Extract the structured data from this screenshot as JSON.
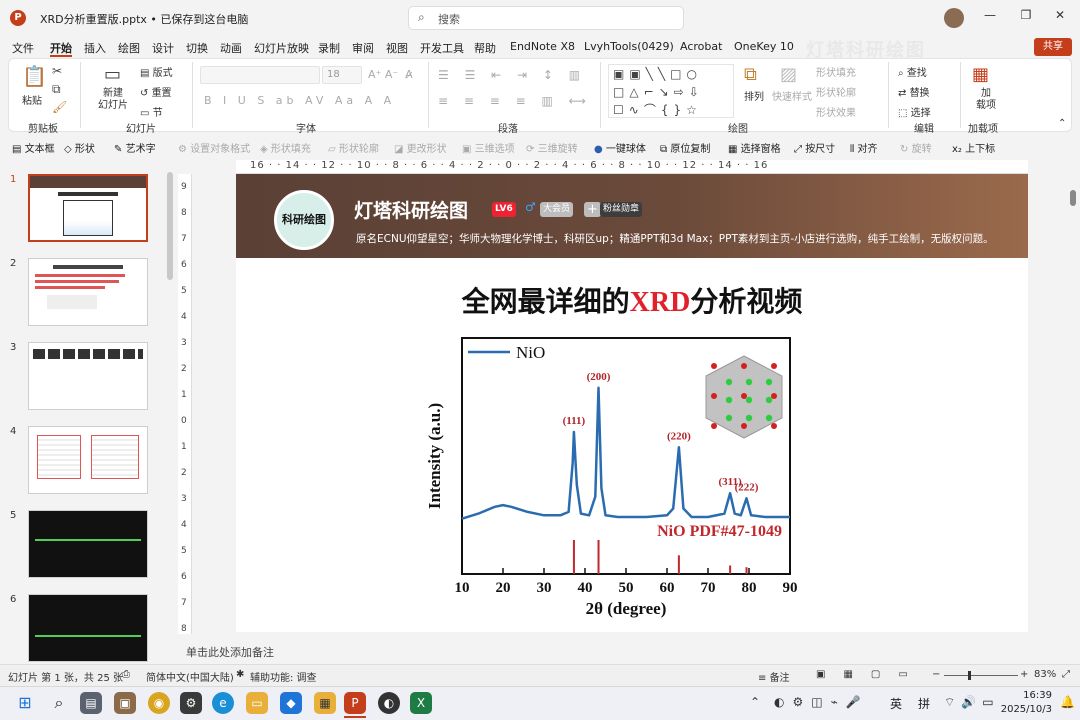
{
  "titlebar": {
    "file_title": "XRD分析重置版.pptx • 已保存到这台电脑",
    "search_placeholder": "搜索",
    "minimize": "—",
    "restore": "❐",
    "close": "✕",
    "logo_letter": "P"
  },
  "menu": [
    "文件",
    "开始",
    "插入",
    "绘图",
    "设计",
    "切换",
    "动画",
    "幻灯片放映",
    "录制",
    "审阅",
    "视图",
    "开发工具",
    "帮助",
    "EndNote X8",
    "LvyhTools(0429)",
    "Acrobat",
    "OneKey 10"
  ],
  "watermark": "灯塔科研绘图",
  "share_label": "共享",
  "ribbon": {
    "groups": [
      "剪贴板",
      "幻灯片",
      "字体",
      "段落",
      "绘图",
      "编辑",
      "加载项"
    ],
    "paste": "粘贴",
    "new_slide": "新建\n幻灯片",
    "layout": "版式",
    "reset": "重置",
    "section": "节",
    "font_size": "18",
    "arrange": "排列",
    "quick_styles": "快速样式",
    "shape_fill": "形状填充",
    "shape_outline": "形状轮廓",
    "shape_effects": "形状效果",
    "find": "查找",
    "replace": "替换",
    "select": "选择",
    "addins": "加\n载项"
  },
  "toolbar2": [
    {
      "label": "文本框",
      "icon": "textbox-icon",
      "enabled": true
    },
    {
      "label": "形状",
      "icon": "shapes-icon",
      "enabled": true
    },
    {
      "label": "艺术字",
      "icon": "wordart-icon",
      "enabled": true
    },
    {
      "label": "设置对象格式",
      "icon": "format-icon",
      "enabled": false
    },
    {
      "label": "形状填充",
      "icon": "fill-icon",
      "enabled": false
    },
    {
      "label": "形状轮廓",
      "icon": "outline-icon",
      "enabled": false
    },
    {
      "label": "更改形状",
      "icon": "change-shape-icon",
      "enabled": false
    },
    {
      "label": "三维选项",
      "icon": "3d-icon",
      "enabled": false
    },
    {
      "label": "三维旋转",
      "icon": "3d-rotate-icon",
      "enabled": false
    },
    {
      "label": "一键球体",
      "icon": "sphere-icon",
      "enabled": true
    },
    {
      "label": "原位复制",
      "icon": "copy-icon",
      "enabled": true
    },
    {
      "label": "选择窗格",
      "icon": "pane-icon",
      "enabled": true
    },
    {
      "label": "按尺寸",
      "icon": "size-icon",
      "enabled": true
    },
    {
      "label": "对齐",
      "icon": "align-icon",
      "enabled": true
    },
    {
      "label": "旋转",
      "icon": "rotate-icon",
      "enabled": false
    },
    {
      "label": "上下标",
      "icon": "subscript-icon",
      "enabled": true
    }
  ],
  "slides": [
    {
      "num": "1",
      "selected": true
    },
    {
      "num": "2",
      "selected": false
    },
    {
      "num": "3",
      "selected": false
    },
    {
      "num": "4",
      "selected": false
    },
    {
      "num": "5",
      "selected": false
    },
    {
      "num": "6",
      "selected": false
    }
  ],
  "ruler_top": "16 · · 14 · · 12 · · 10 · · 8 · · 6 · · 4 · · 2 · · 0 · · 2 · · 4 · · 6 · · 8 · · 10 · · 12 · · 14 · · 16",
  "ruler_left": "9 8 7 6 5 4 3 2 1 0 1 2 3 4 5 6 7 8",
  "slide": {
    "banner": {
      "name": "灯塔科研绘图",
      "logo_text": "科研绘图",
      "level": "LV6",
      "vip": "大会员",
      "medal": "粉丝勋章",
      "desc": "原名ECNU仰望星空；华师大物理化学博士，科研区up；精通PPT和3d Max；PPT素材到主页-小店进行选购，纯手工绘制，无版权问题。"
    },
    "title_pre": "全网最详细的",
    "title_red": "XRD",
    "title_post": "分析视频"
  },
  "chart_data": {
    "type": "line",
    "xlabel": "2θ (degree)",
    "ylabel": "Intensity (a.u.)",
    "xlim": [
      10,
      90
    ],
    "xticks": [
      10,
      20,
      30,
      40,
      50,
      60,
      70,
      80,
      90
    ],
    "series": [
      {
        "name": "NiO",
        "color": "#2b6cb0",
        "x": [
          10,
          14,
          18,
          20,
          22,
          26,
          30,
          34,
          36,
          37,
          37.3,
          38,
          39,
          41,
          42.5,
          43.3,
          44,
          45,
          48,
          55,
          60,
          61.5,
          62.9,
          64,
          66,
          70,
          74,
          75.4,
          76.5,
          78,
          79.4,
          80.5,
          84,
          90
        ],
        "y": [
          0.02,
          0.05,
          0.09,
          0.1,
          0.09,
          0.06,
          0.04,
          0.04,
          0.06,
          0.35,
          0.53,
          0.22,
          0.05,
          0.04,
          0.15,
          0.79,
          0.2,
          0.04,
          0.03,
          0.03,
          0.04,
          0.08,
          0.44,
          0.08,
          0.03,
          0.03,
          0.05,
          0.17,
          0.05,
          0.04,
          0.14,
          0.04,
          0.03,
          0.03
        ]
      }
    ],
    "peaks": [
      {
        "hkl": "(111)",
        "x": 37.3
      },
      {
        "hkl": "(200)",
        "x": 43.3
      },
      {
        "hkl": "(220)",
        "x": 62.9
      },
      {
        "hkl": "(311)",
        "x": 75.4
      },
      {
        "hkl": "(222)",
        "x": 79.4
      }
    ],
    "reference": {
      "label": "NiO PDF#47-1049",
      "color": "#c0282d",
      "lines": [
        {
          "x": 37.3,
          "h": 1.0
        },
        {
          "x": 43.3,
          "h": 1.0
        },
        {
          "x": 62.9,
          "h": 0.55
        },
        {
          "x": 75.4,
          "h": 0.25
        },
        {
          "x": 79.4,
          "h": 0.2
        }
      ]
    },
    "legend": "top-left"
  },
  "notes_placeholder": "单击此处添加备注",
  "status": {
    "slide_info": "幻灯片 第 1 张，共 25 张",
    "language": "简体中文(中国大陆)",
    "accessibility": "辅助功能: 调查",
    "notes": "备注",
    "zoom": "83%"
  },
  "taskbar": {
    "ime": "英",
    "ime2": "拼",
    "time": "16:39",
    "date": "2025/10/3"
  }
}
